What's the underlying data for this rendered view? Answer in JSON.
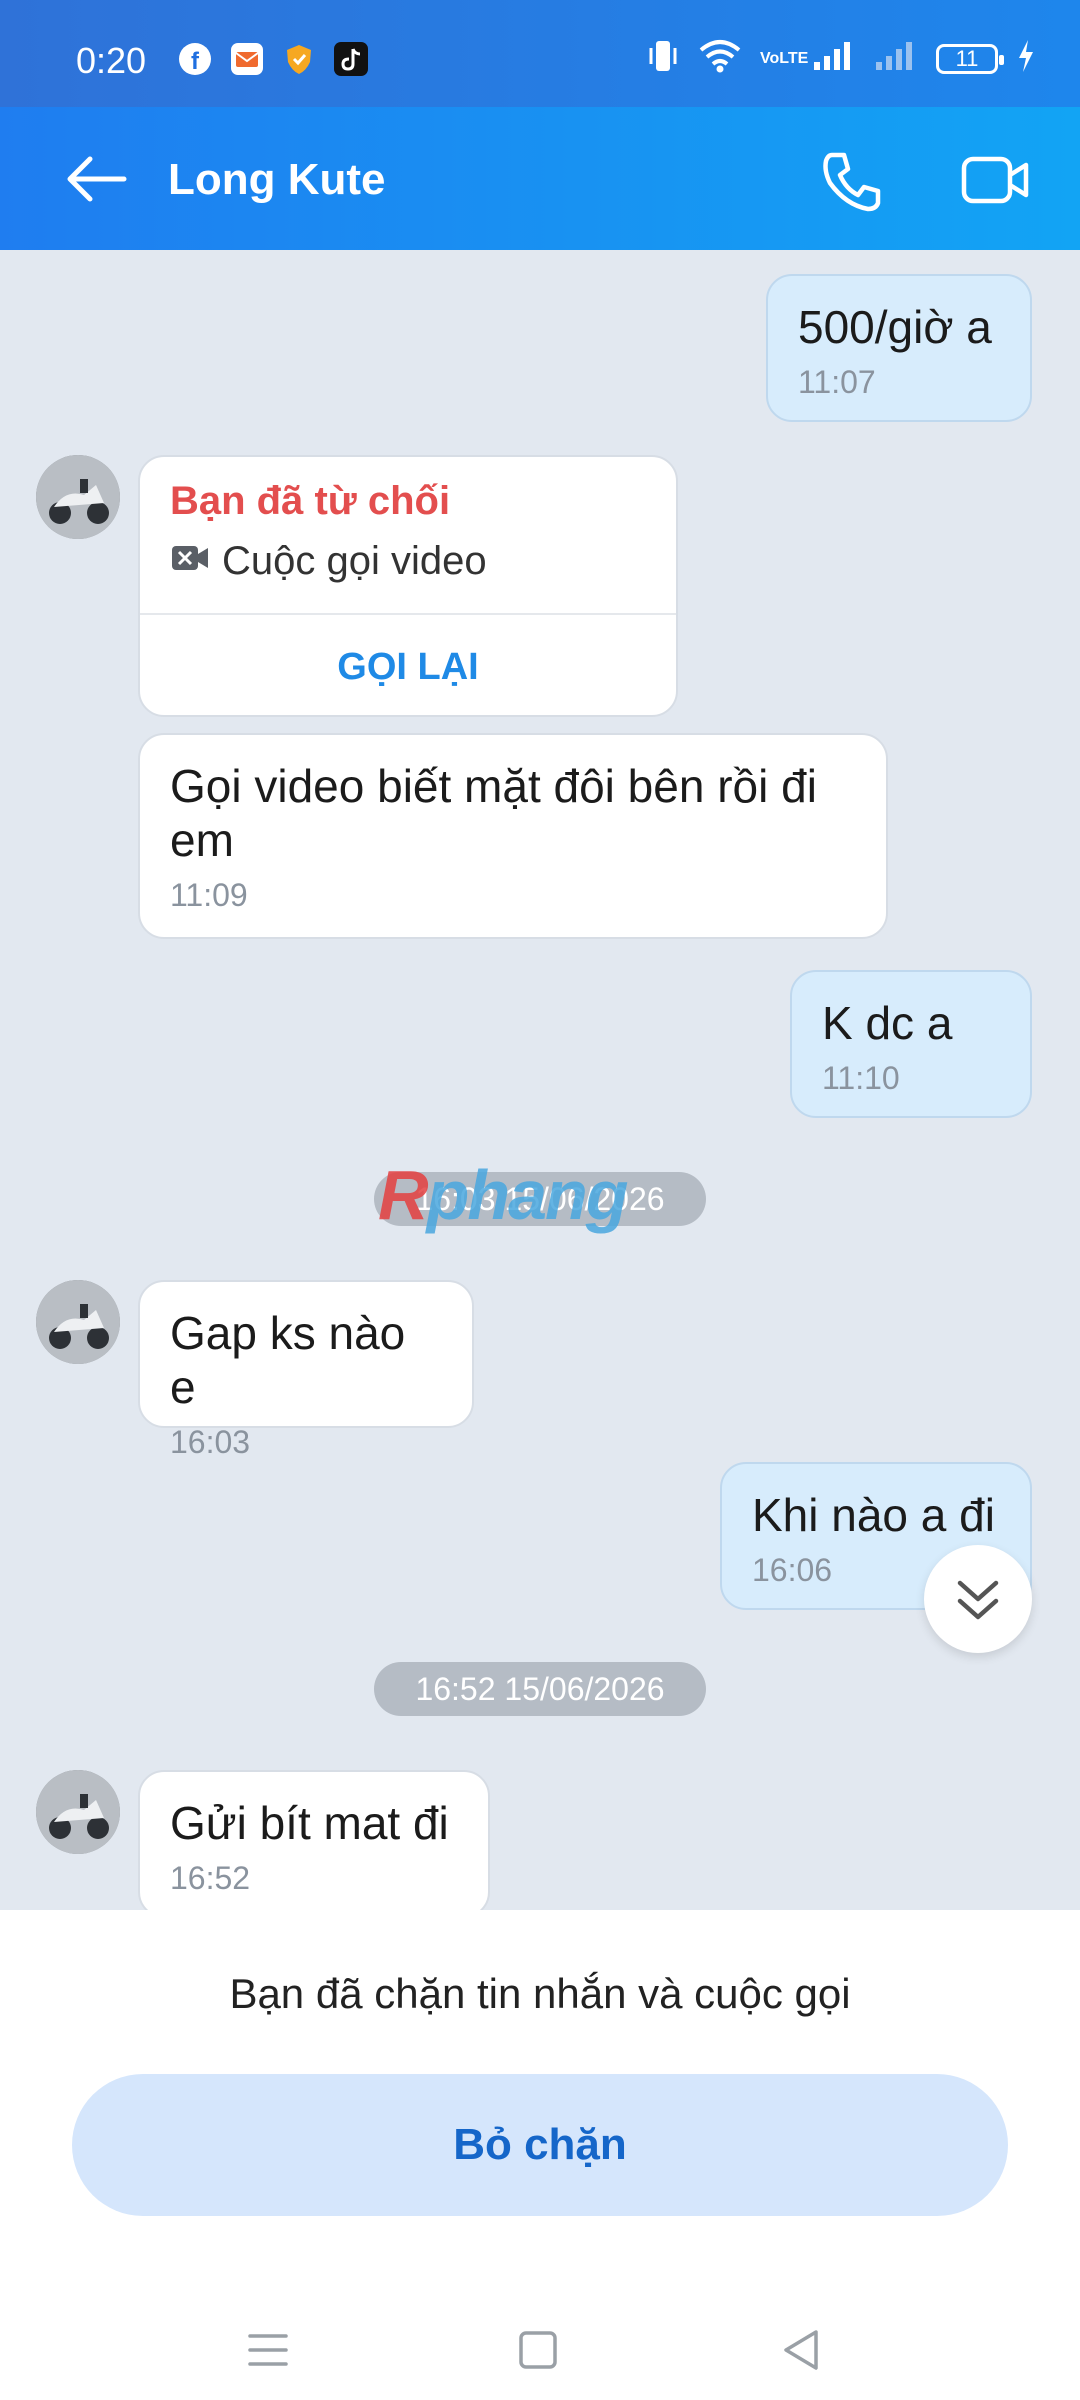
{
  "status_bar": {
    "time": "0:20",
    "battery": "11",
    "network": "VoLTE"
  },
  "header": {
    "back_icon": "arrow-left-icon",
    "contact_name": "Long Kute",
    "call_icon": "phone-icon",
    "video_icon": "video-camera-icon"
  },
  "messages": [
    {
      "dir": "out",
      "text": "500/giờ a",
      "time": "11:07"
    },
    {
      "dir": "in",
      "kind": "call",
      "status": "Bạn đã từ chối",
      "call_type": "Cuộc gọi video",
      "action": "GỌI LẠI"
    },
    {
      "dir": "in",
      "text": "Gọi video biết mặt đôi bên rồi đi em",
      "time": "11:09"
    },
    {
      "dir": "out",
      "text": "K dc a",
      "time": "11:10"
    },
    {
      "kind": "divider",
      "text": "16:03 15/06/2026"
    },
    {
      "dir": "in",
      "text": "Gap ks nào e",
      "time": "16:03"
    },
    {
      "dir": "out",
      "text": "Khi nào a đi",
      "time": "16:06"
    },
    {
      "kind": "divider",
      "text": "16:52 15/06/2026"
    },
    {
      "dir": "in",
      "text": "Gửi bít mat đi",
      "time": "16:52"
    }
  ],
  "watermark": {
    "part1": "R",
    "part2": "phang"
  },
  "blocked_panel": {
    "notice": "Bạn đã chặn tin nhắn và cuộc gọi",
    "unblock_label": "Bỏ chặn"
  },
  "colors": {
    "header": "#1f7df0",
    "outgoing_bubble": "#d7ecfc",
    "missed_call": "#e34e4e",
    "accent": "#1566c9"
  }
}
